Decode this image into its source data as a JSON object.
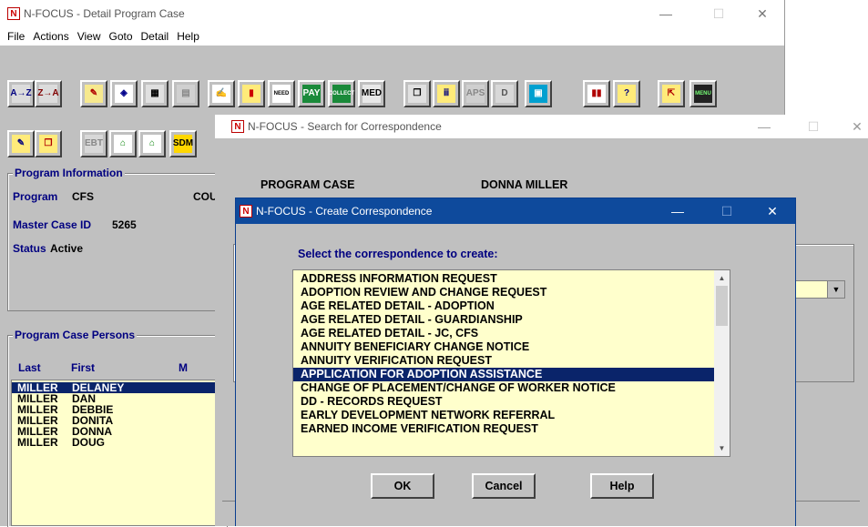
{
  "main_window": {
    "title": "N-FOCUS - Detail Program Case",
    "icon": "N",
    "controls": {
      "minimize": "—",
      "maximize": "☐",
      "close": "✕"
    },
    "menu": [
      "File",
      "Actions",
      "View",
      "Goto",
      "Detail",
      "Help"
    ],
    "toolbar1": [
      {
        "icon": "sort-ascending-icon",
        "glyph": "A→Z"
      },
      {
        "icon": "sort-descending-icon",
        "glyph": "Z→A"
      },
      {
        "icon": "edit-pen-icon",
        "glyph": "✎"
      },
      {
        "icon": "eraser-icon",
        "glyph": "◈"
      },
      {
        "icon": "calculator-icon",
        "glyph": "▦"
      },
      {
        "icon": "disabled-list-icon",
        "glyph": "▤"
      },
      {
        "icon": "notepad-icon",
        "glyph": "✍"
      },
      {
        "icon": "bookmark-icon",
        "glyph": "▮"
      },
      {
        "icon": "needs-icon",
        "glyph": "NEED"
      },
      {
        "icon": "pay-icon",
        "glyph": "PAY"
      },
      {
        "icon": "collect-icon",
        "glyph": "COLLECT"
      },
      {
        "icon": "med-icon",
        "glyph": "MED"
      },
      {
        "icon": "copy-icon",
        "glyph": "❐"
      },
      {
        "icon": "people-icon",
        "glyph": "ⅲ"
      },
      {
        "icon": "aps-icon",
        "glyph": "APS"
      },
      {
        "icon": "d-icon",
        "glyph": "D"
      },
      {
        "icon": "panel-icon",
        "glyph": "▣"
      },
      {
        "icon": "bar-chart-icon",
        "glyph": "▮▮"
      },
      {
        "icon": "help-question-icon",
        "glyph": "?"
      },
      {
        "icon": "exit-folder-icon",
        "glyph": "⇱"
      },
      {
        "icon": "menu-icon",
        "glyph": "MENU"
      }
    ],
    "toolbar2": [
      {
        "icon": "document-edit-icon",
        "glyph": "✎"
      },
      {
        "icon": "copy-pages-icon",
        "glyph": "❐"
      },
      {
        "icon": "ebt-card-icon",
        "glyph": "EBT"
      },
      {
        "icon": "house-add-icon",
        "glyph": "⌂"
      },
      {
        "icon": "house-family-icon",
        "glyph": "⌂"
      },
      {
        "icon": "sdm-icon",
        "glyph": "SDM"
      }
    ],
    "program_information": {
      "title": "Program Information",
      "program_label": "Program",
      "program_value": "CFS",
      "county_label": "COU",
      "master_case_label": "Master Case ID",
      "master_case_value": "5265",
      "status_label": "Status",
      "status_value": "Active"
    },
    "program_case_persons": {
      "title": "Program Case Persons",
      "headers": [
        "Last",
        "First",
        "M"
      ],
      "rows": [
        {
          "last": "MILLER",
          "first": "DELANEY"
        },
        {
          "last": "MILLER",
          "first": "DAN"
        },
        {
          "last": "MILLER",
          "first": "DEBBIE"
        },
        {
          "last": "MILLER",
          "first": "DONITA"
        },
        {
          "last": "MILLER",
          "first": "DONNA"
        },
        {
          "last": "MILLER",
          "first": "DOUG"
        }
      ]
    }
  },
  "search_window": {
    "title": "N-FOCUS - Search for Correspondence",
    "icon": "N",
    "program_case_label": "PROGRAM CASE",
    "person_name": "DONNA MILLER",
    "dropdown_arrow": "▼"
  },
  "create_dialog": {
    "title": "N-FOCUS - Create Correspondence",
    "icon": "N",
    "prompt": "Select the correspondence to create:",
    "items": [
      "ADDRESS INFORMATION REQUEST",
      "ADOPTION REVIEW AND CHANGE REQUEST",
      "AGE RELATED DETAIL - ADOPTION",
      "AGE RELATED DETAIL - GUARDIANSHIP",
      "AGE RELATED DETAIL - JC, CFS",
      "ANNUITY BENEFICIARY CHANGE NOTICE",
      "ANNUITY VERIFICATION REQUEST",
      "APPLICATION FOR ADOPTION ASSISTANCE",
      "CHANGE OF PLACEMENT/CHANGE OF WORKER NOTICE",
      "DD - RECORDS REQUEST",
      "EARLY DEVELOPMENT NETWORK REFERRAL",
      "EARNED INCOME VERIFICATION REQUEST"
    ],
    "selected_index": 7,
    "scroll_up": "▲",
    "scroll_down": "▼",
    "ok_label": "OK",
    "cancel_label": "Cancel",
    "help_label": "Help"
  }
}
